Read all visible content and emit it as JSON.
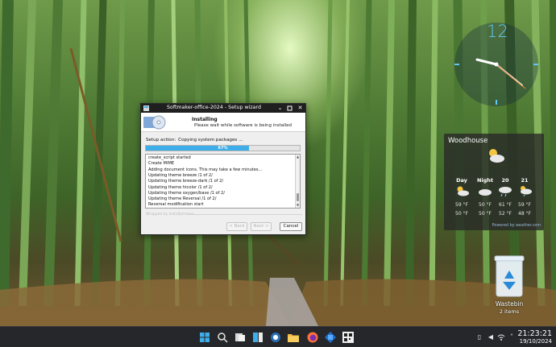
{
  "desktop": {
    "clock_number": "12",
    "weather": {
      "location": "Woodhouse",
      "columns": [
        {
          "label": "Day",
          "high": "59 °F",
          "low": "50 °F"
        },
        {
          "label": "Night",
          "high": "50 °F",
          "low": "50 °F"
        },
        {
          "label": "20",
          "high": "61 °F",
          "low": "52 °F"
        },
        {
          "label": "21",
          "high": "59 °F",
          "low": "48 °F"
        }
      ],
      "credit": "Powered by weather.com"
    },
    "wastebin": {
      "label": "Wastebin",
      "count": "2 items"
    }
  },
  "dialog": {
    "title": "Softmaker-office-2024 - Setup wizard",
    "header_title": "Installing",
    "header_subtitle": "Please wait while software is being installed",
    "setup_action_label": "Setup action:",
    "setup_action_value": "Copying system packages ...",
    "progress": {
      "percent": 67,
      "text": "67%"
    },
    "log_lines": [
      "create_script started",
      "Create MIME",
      "Adding document icons. This may take a few minutes...",
      "Updating theme breeze /1 of 2/",
      "Updating theme breeze-dark /1 of 2/",
      "Updating theme hicolor /1 of 2/",
      "Updating theme oxygen/base /1 of 2/",
      "Updating theme Reversal /1 of 2/",
      "Reversal modification start"
    ],
    "brand": "Wrapped by InstallJammer",
    "buttons": {
      "back": "< Back",
      "next": "Next >",
      "cancel": "Cancel"
    }
  },
  "taskbar": {
    "time": "21:23:21",
    "date": "19/10/2024"
  },
  "colors": {
    "accent": "#3daee9",
    "clock_accent": "#5fc8f0",
    "taskbar": "#25272b"
  }
}
